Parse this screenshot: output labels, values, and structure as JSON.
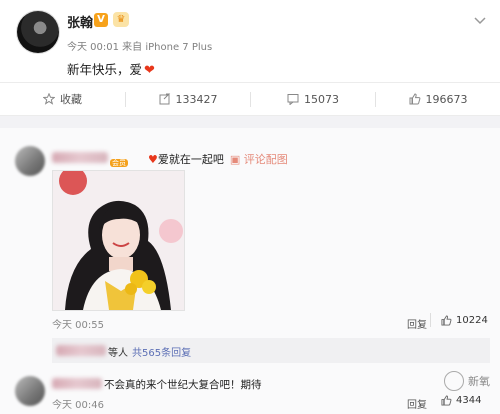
{
  "post": {
    "username": "张翰",
    "v_badge": "V",
    "meta": "今天 00:01 来自 iPhone 7 Plus",
    "text": "新年快乐，爱",
    "text_emoji": "red-heart-icon"
  },
  "actions": {
    "favorite_label": "收藏",
    "repost_count": "133427",
    "comment_count": "15073",
    "like_count": "196673"
  },
  "comments": [
    {
      "vip_label": "会员",
      "text_prefix_heart": "♥",
      "text": "爱就在一起吧",
      "rated_label": "评论配图",
      "time": "今天 00:55",
      "reply_label": "回复",
      "like_count": "10224"
    },
    {
      "text": "不会真的来个世纪大复合吧！期待",
      "time": "今天 00:46",
      "reply_label": "回复",
      "like_count": "4344"
    }
  ],
  "sub_reply": {
    "suffix": "等人",
    "total_label": "共565条回复"
  },
  "watermark": {
    "text": "新氧"
  }
}
